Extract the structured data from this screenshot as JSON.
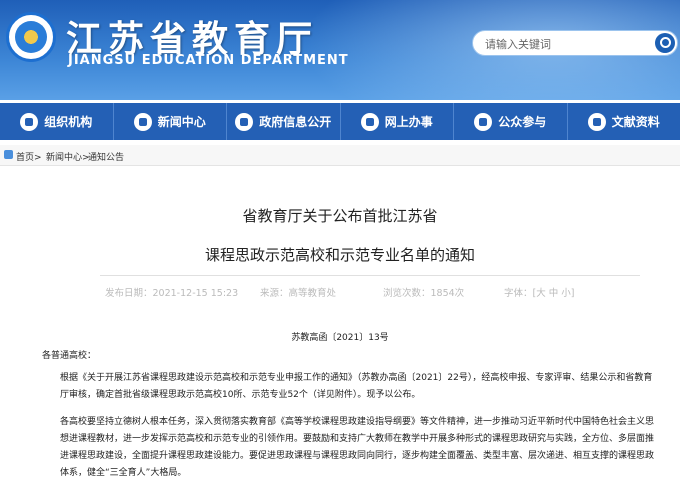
{
  "header": {
    "title": "江苏省教育厅",
    "subtitle": "JIANGSU EDUCATION DEPARTMENT",
    "search_placeholder": "请输入关键词"
  },
  "nav": {
    "items": [
      {
        "label": "组织机构",
        "icon": "org-icon"
      },
      {
        "label": "新闻中心",
        "icon": "news-icon"
      },
      {
        "label": "政府信息公开",
        "icon": "gov-info-icon"
      },
      {
        "label": "网上办事",
        "icon": "online-service-icon"
      },
      {
        "label": "公众参与",
        "icon": "public-icon"
      },
      {
        "label": "文献资料",
        "icon": "document-icon"
      }
    ]
  },
  "breadcrumb": {
    "items": [
      "首页",
      "新闻中心",
      "通知公告"
    ],
    "separator": ">"
  },
  "article": {
    "title_line1": "省教育厅关于公布首批江苏省",
    "title_line2": "课程思政示范高校和示范专业名单的通知",
    "publish_time": "发布日期：2021-12-15 15:23",
    "source": "来源：高等教育处",
    "views": "浏览次数：1854次",
    "font_size": "字体：[大 中 小]",
    "doc_no": "苏教高函〔2021〕13号",
    "greeting": "各普通高校：",
    "para1": "根据《关于开展江苏省课程思政建设示范高校和示范专业申报工作的通知》（苏教办高函〔2021〕22号），经高校申报、专家评审、结果公示和省教育厅审核，确定首批省级课程思政示范高校10所、示范专业52个（详见附件）。现予以公布。",
    "para2": "各高校要坚持立德树人根本任务，深入贯彻落实教育部《高等学校课程思政建设指导纲要》等文件精神，进一步推动习近平新时代中国特色社会主义思想进课程教材，进一步发挥示范高校和示范专业的引领作用。要鼓励和支持广大教师在教学中开展多种形式的课程思政研究与实践，全方位、多层面推进课程思政建设，全面提升课程思政建设能力。要促进思政课程与课程思政同向同行，逐步构建全面覆盖、类型丰富、层次递进、相互支撑的课程思政体系，健全“三全育人”大格局。"
  },
  "colors": {
    "header_blue": "#2460b5",
    "accent": "#1c5fb3"
  }
}
